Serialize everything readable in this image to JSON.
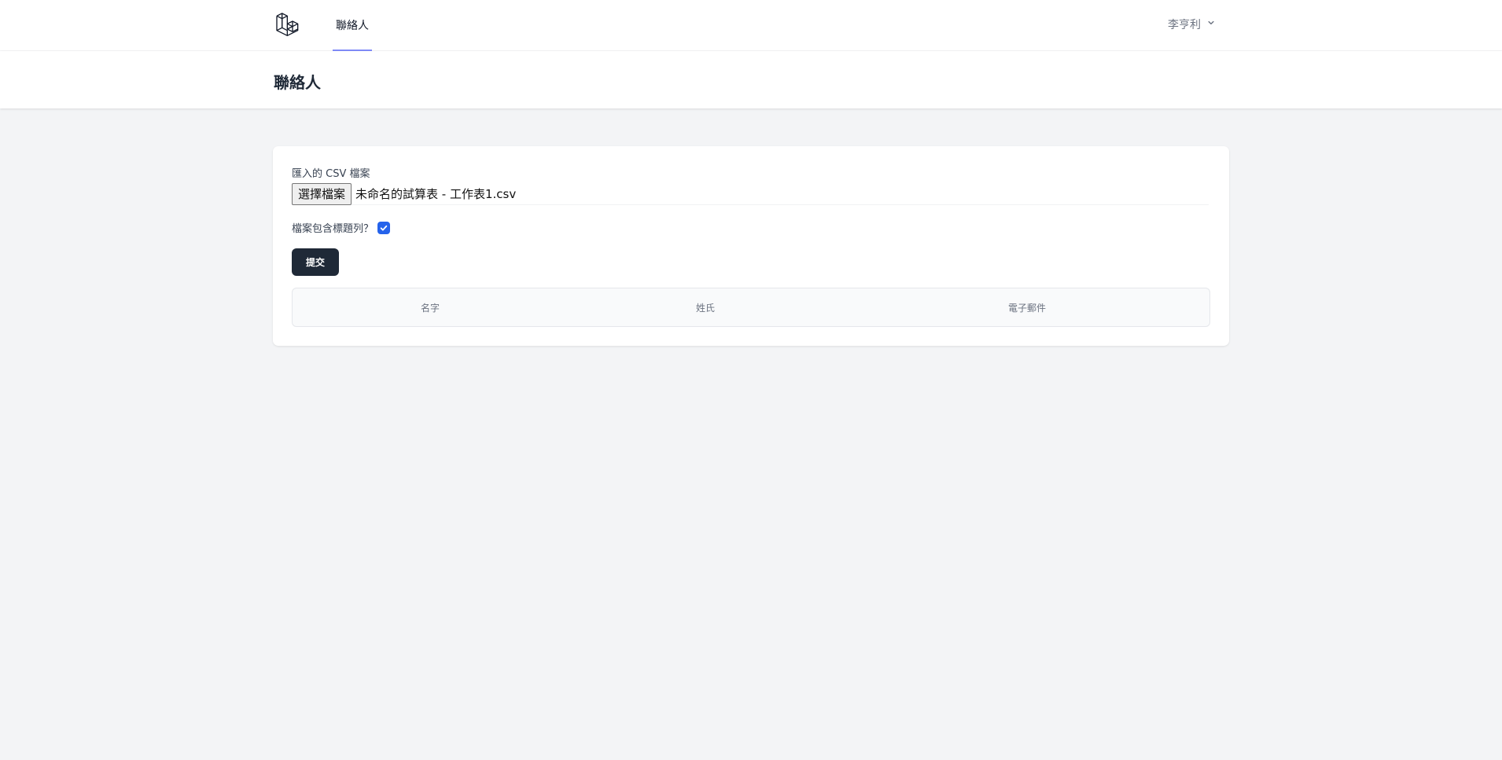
{
  "app": {
    "icons": {
      "logo": "laravel-logo-icon",
      "user_chevron": "chevron-down-icon",
      "check": "check-icon"
    },
    "colors": {
      "accent": "#818cf8",
      "primary_button": "#1f2937",
      "checkbox": "#2563eb"
    }
  },
  "nav": {
    "tabs": [
      {
        "label": "聯絡人",
        "active": true
      }
    ],
    "user": {
      "name": "李亨利"
    }
  },
  "header": {
    "title": "聯絡人"
  },
  "form": {
    "file_label": "匯入的 CSV 檔案",
    "file_button": "選擇檔案",
    "file_name": "未命名的試算表 - 工作表1.csv",
    "header_checkbox_label": "檔案包含標題列？",
    "header_checkbox_checked": true,
    "submit_label": "提交"
  },
  "table": {
    "columns": [
      "名字",
      "姓氏",
      "電子郵件"
    ],
    "rows": []
  }
}
